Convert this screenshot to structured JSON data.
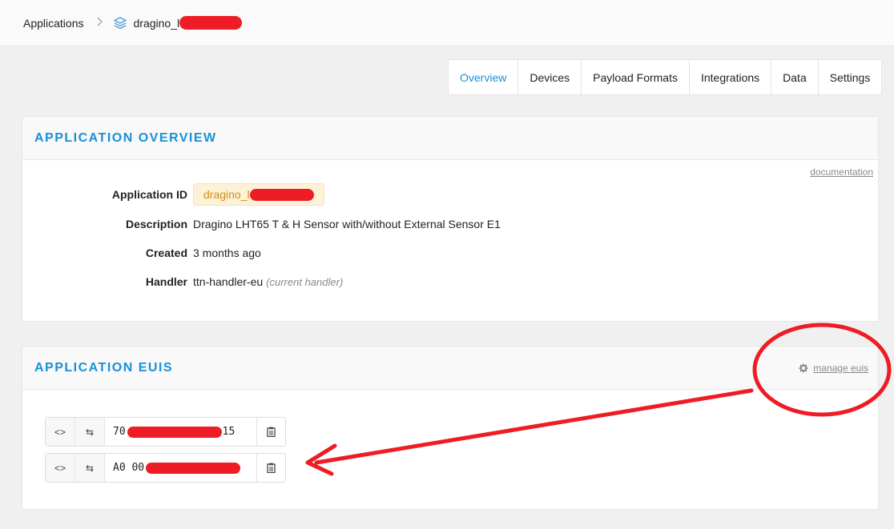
{
  "breadcrumb": {
    "root": "Applications",
    "separator": ">",
    "app": "dragino_l"
  },
  "tabs": [
    {
      "label": "Overview",
      "active": true
    },
    {
      "label": "Devices"
    },
    {
      "label": "Payload Formats"
    },
    {
      "label": "Integrations"
    },
    {
      "label": "Data"
    },
    {
      "label": "Settings"
    }
  ],
  "overview": {
    "title": "APPLICATION OVERVIEW",
    "documentation_link": "documentation",
    "fields": {
      "app_id_label": "Application ID",
      "app_id_value": "dragino_l",
      "description_label": "Description",
      "description_value": "Dragino LHT65 T & H Sensor with/without External Sensor E1",
      "created_label": "Created",
      "created_value": "3 months ago",
      "handler_label": "Handler",
      "handler_value": "ttn-handler-eu",
      "handler_note": "(current handler)"
    }
  },
  "euis": {
    "title": "APPLICATION EUIS",
    "manage_label": "manage euis",
    "rows": [
      {
        "prefix": "70",
        "suffix": "15"
      },
      {
        "prefix": "A0 00",
        "suffix": ""
      }
    ],
    "code_symbol": "<>",
    "swap_symbol": "⇆"
  },
  "colors": {
    "accent": "#1a8fd6",
    "badge_bg": "#fdf1d6",
    "badge_text": "#d2901a",
    "annotation_red": "#ee1c25"
  }
}
